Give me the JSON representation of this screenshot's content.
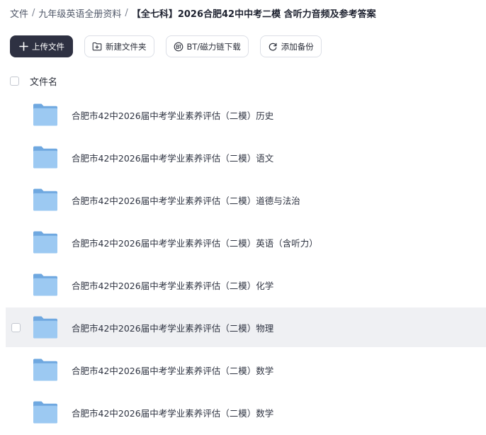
{
  "breadcrumb": {
    "root": "文件",
    "parent": "九年级英语全册资料",
    "current": "【全七科】2026合肥42中中考二模 含听力音频及参考答案",
    "separator": "/"
  },
  "toolbar": {
    "upload_label": "上传文件",
    "new_folder_label": "新建文件夹",
    "bt_label": "BT/磁力链下载",
    "backup_label": "添加备份"
  },
  "list_header": {
    "name_label": "文件名"
  },
  "files": [
    {
      "name": "合肥市42中2026届中考学业素养评估（二模）历史",
      "type": "folder"
    },
    {
      "name": "合肥市42中2026届中考学业素养评估（二模）语文",
      "type": "folder"
    },
    {
      "name": "合肥市42中2026届中考学业素养评估（二模）道德与法治",
      "type": "folder"
    },
    {
      "name": "合肥市42中2026届中考学业素养评估（二模）英语（含听力）",
      "type": "folder"
    },
    {
      "name": "合肥市42中2026届中考学业素养评估（二模）化学",
      "type": "folder"
    },
    {
      "name": "合肥市42中2026届中考学业素养评估（二模）物理",
      "type": "folder",
      "hovered": true
    },
    {
      "name": "合肥市42中2026届中考学业素养评估（二模）数学",
      "type": "folder"
    },
    {
      "name": "合肥市42中2026届中考学业素养评估（二模）数学",
      "type": "folder"
    }
  ],
  "colors": {
    "primary_button": "#2e3142",
    "folder_back": "#6fa8e0",
    "folder_front": "#9cc9f2",
    "row_hover": "#eff0f3"
  },
  "icons": {
    "upload": "plus-icon",
    "new_folder": "folder-plus-icon",
    "bt": "bt-icon",
    "backup": "sync-icon",
    "file": "folder-icon"
  }
}
